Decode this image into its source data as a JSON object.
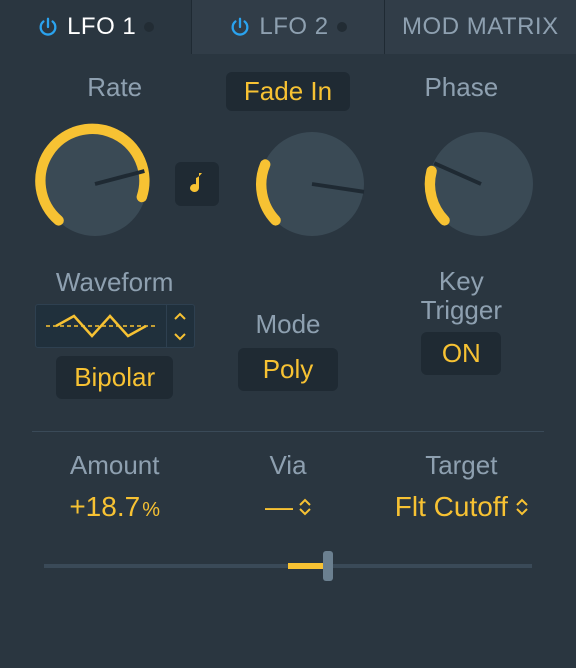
{
  "tabs": {
    "lfo1": {
      "label": "LFO 1",
      "active": true,
      "power_color": "#2aa3ef"
    },
    "lfo2": {
      "label": "LFO 2",
      "active": false,
      "power_color": "#2aa3ef"
    },
    "modmatrix": {
      "label": "MOD MATRIX"
    }
  },
  "labels": {
    "rate": "Rate",
    "fadein": "Fade In",
    "phase": "Phase",
    "waveform": "Waveform",
    "mode": "Mode",
    "keytrigger_l1": "Key",
    "keytrigger_l2": "Trigger",
    "amount": "Amount",
    "via": "Via",
    "target": "Target"
  },
  "values": {
    "bipolar": "Bipolar",
    "mode": "Poly",
    "keytrigger": "ON",
    "amount": "+18.7",
    "amount_unit": "%",
    "via": "—",
    "target": "Flt Cutoff"
  },
  "knobs": {
    "rate_angle_deg": 200,
    "fadein_angle_deg": 75,
    "phase_angle_deg": 80
  },
  "colors": {
    "accent": "#f7c233",
    "bg": "#2a3640",
    "dark": "#1f2a33"
  }
}
